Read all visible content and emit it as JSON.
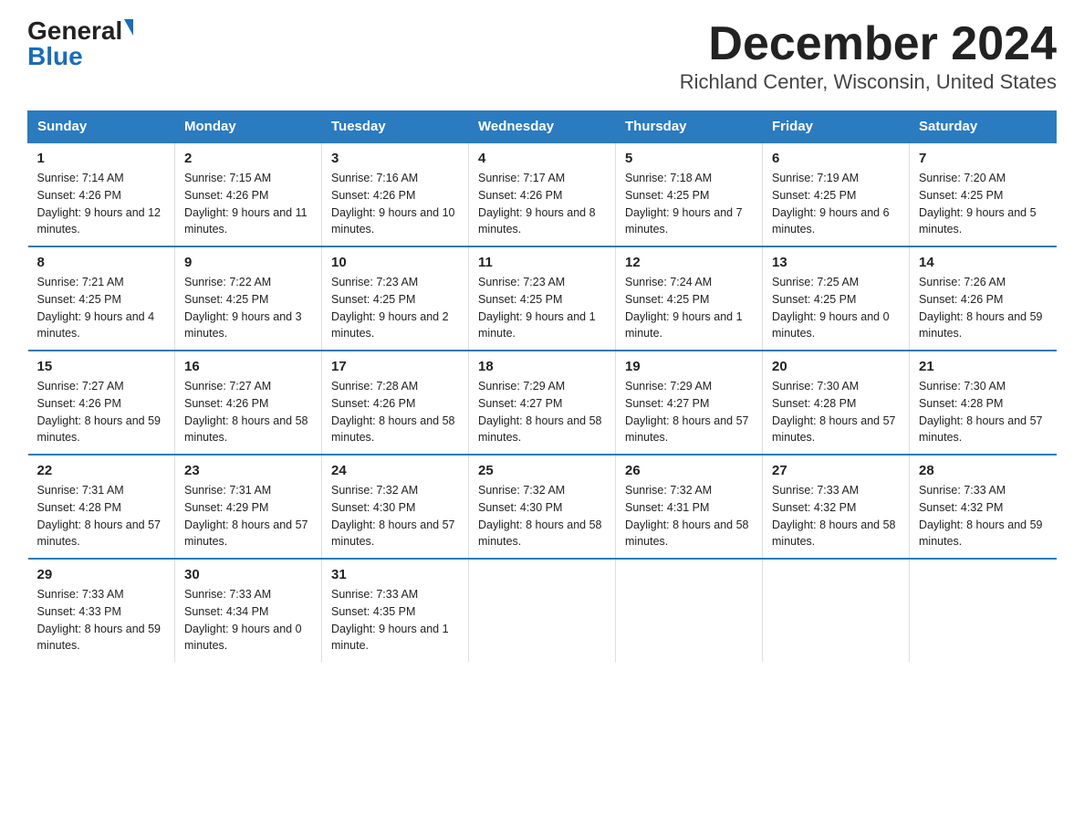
{
  "logo": {
    "general": "General",
    "blue": "Blue"
  },
  "title": "December 2024",
  "location": "Richland Center, Wisconsin, United States",
  "days_of_week": [
    "Sunday",
    "Monday",
    "Tuesday",
    "Wednesday",
    "Thursday",
    "Friday",
    "Saturday"
  ],
  "weeks": [
    [
      {
        "day": "1",
        "sunrise": "7:14 AM",
        "sunset": "4:26 PM",
        "daylight": "9 hours and 12 minutes."
      },
      {
        "day": "2",
        "sunrise": "7:15 AM",
        "sunset": "4:26 PM",
        "daylight": "9 hours and 11 minutes."
      },
      {
        "day": "3",
        "sunrise": "7:16 AM",
        "sunset": "4:26 PM",
        "daylight": "9 hours and 10 minutes."
      },
      {
        "day": "4",
        "sunrise": "7:17 AM",
        "sunset": "4:26 PM",
        "daylight": "9 hours and 8 minutes."
      },
      {
        "day": "5",
        "sunrise": "7:18 AM",
        "sunset": "4:25 PM",
        "daylight": "9 hours and 7 minutes."
      },
      {
        "day": "6",
        "sunrise": "7:19 AM",
        "sunset": "4:25 PM",
        "daylight": "9 hours and 6 minutes."
      },
      {
        "day": "7",
        "sunrise": "7:20 AM",
        "sunset": "4:25 PM",
        "daylight": "9 hours and 5 minutes."
      }
    ],
    [
      {
        "day": "8",
        "sunrise": "7:21 AM",
        "sunset": "4:25 PM",
        "daylight": "9 hours and 4 minutes."
      },
      {
        "day": "9",
        "sunrise": "7:22 AM",
        "sunset": "4:25 PM",
        "daylight": "9 hours and 3 minutes."
      },
      {
        "day": "10",
        "sunrise": "7:23 AM",
        "sunset": "4:25 PM",
        "daylight": "9 hours and 2 minutes."
      },
      {
        "day": "11",
        "sunrise": "7:23 AM",
        "sunset": "4:25 PM",
        "daylight": "9 hours and 1 minute."
      },
      {
        "day": "12",
        "sunrise": "7:24 AM",
        "sunset": "4:25 PM",
        "daylight": "9 hours and 1 minute."
      },
      {
        "day": "13",
        "sunrise": "7:25 AM",
        "sunset": "4:25 PM",
        "daylight": "9 hours and 0 minutes."
      },
      {
        "day": "14",
        "sunrise": "7:26 AM",
        "sunset": "4:26 PM",
        "daylight": "8 hours and 59 minutes."
      }
    ],
    [
      {
        "day": "15",
        "sunrise": "7:27 AM",
        "sunset": "4:26 PM",
        "daylight": "8 hours and 59 minutes."
      },
      {
        "day": "16",
        "sunrise": "7:27 AM",
        "sunset": "4:26 PM",
        "daylight": "8 hours and 58 minutes."
      },
      {
        "day": "17",
        "sunrise": "7:28 AM",
        "sunset": "4:26 PM",
        "daylight": "8 hours and 58 minutes."
      },
      {
        "day": "18",
        "sunrise": "7:29 AM",
        "sunset": "4:27 PM",
        "daylight": "8 hours and 58 minutes."
      },
      {
        "day": "19",
        "sunrise": "7:29 AM",
        "sunset": "4:27 PM",
        "daylight": "8 hours and 57 minutes."
      },
      {
        "day": "20",
        "sunrise": "7:30 AM",
        "sunset": "4:28 PM",
        "daylight": "8 hours and 57 minutes."
      },
      {
        "day": "21",
        "sunrise": "7:30 AM",
        "sunset": "4:28 PM",
        "daylight": "8 hours and 57 minutes."
      }
    ],
    [
      {
        "day": "22",
        "sunrise": "7:31 AM",
        "sunset": "4:28 PM",
        "daylight": "8 hours and 57 minutes."
      },
      {
        "day": "23",
        "sunrise": "7:31 AM",
        "sunset": "4:29 PM",
        "daylight": "8 hours and 57 minutes."
      },
      {
        "day": "24",
        "sunrise": "7:32 AM",
        "sunset": "4:30 PM",
        "daylight": "8 hours and 57 minutes."
      },
      {
        "day": "25",
        "sunrise": "7:32 AM",
        "sunset": "4:30 PM",
        "daylight": "8 hours and 58 minutes."
      },
      {
        "day": "26",
        "sunrise": "7:32 AM",
        "sunset": "4:31 PM",
        "daylight": "8 hours and 58 minutes."
      },
      {
        "day": "27",
        "sunrise": "7:33 AM",
        "sunset": "4:32 PM",
        "daylight": "8 hours and 58 minutes."
      },
      {
        "day": "28",
        "sunrise": "7:33 AM",
        "sunset": "4:32 PM",
        "daylight": "8 hours and 59 minutes."
      }
    ],
    [
      {
        "day": "29",
        "sunrise": "7:33 AM",
        "sunset": "4:33 PM",
        "daylight": "8 hours and 59 minutes."
      },
      {
        "day": "30",
        "sunrise": "7:33 AM",
        "sunset": "4:34 PM",
        "daylight": "9 hours and 0 minutes."
      },
      {
        "day": "31",
        "sunrise": "7:33 AM",
        "sunset": "4:35 PM",
        "daylight": "9 hours and 1 minute."
      },
      null,
      null,
      null,
      null
    ]
  ]
}
